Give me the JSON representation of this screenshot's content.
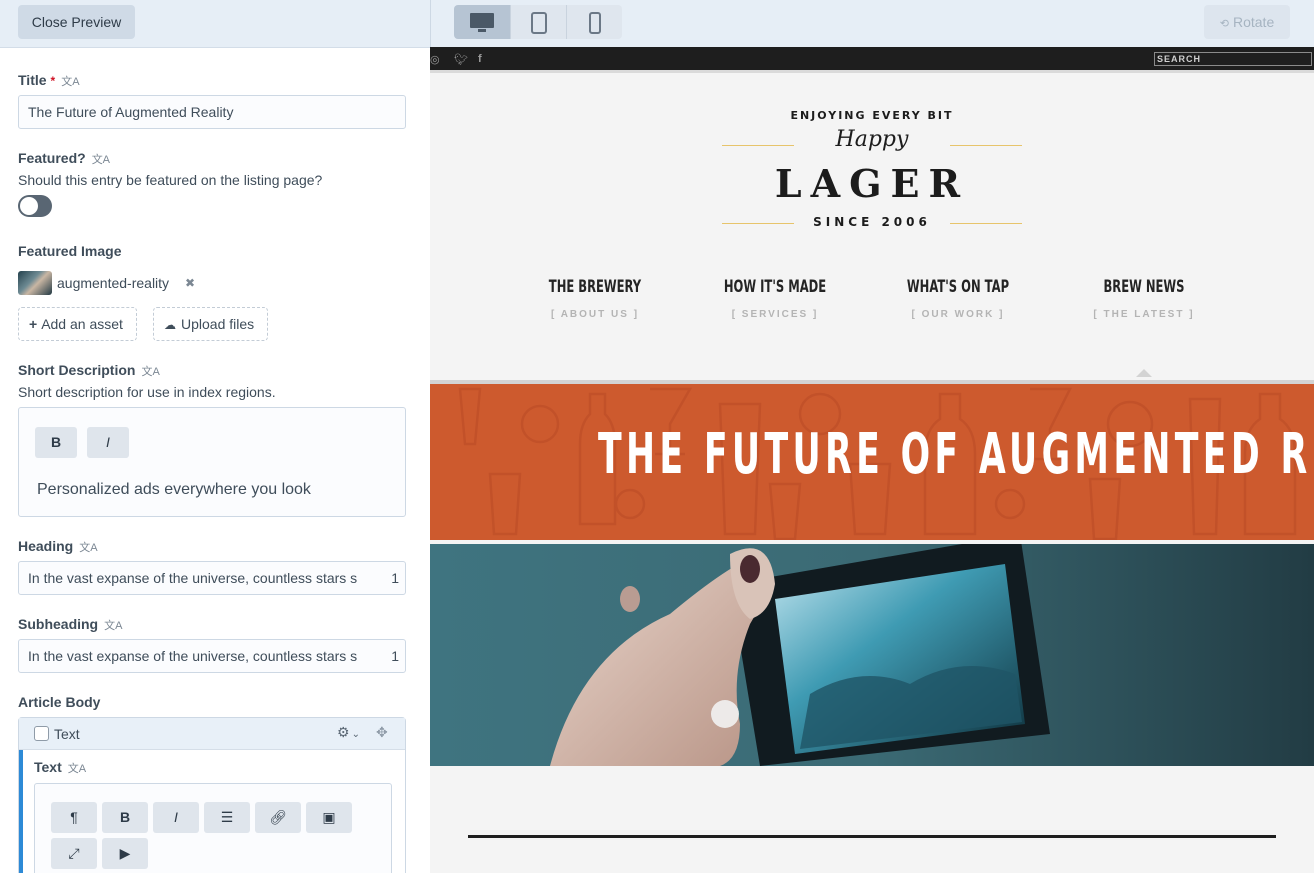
{
  "editor": {
    "close_preview": "Close Preview",
    "title": {
      "label": "Title",
      "required_mark": "*",
      "value": "The Future of Augmented Reality"
    },
    "featured": {
      "label": "Featured?",
      "help": "Should this entry be featured on the listing page?",
      "value": false
    },
    "featured_image": {
      "label": "Featured Image",
      "asset_name": "augmented-reality",
      "add_asset": "Add an asset",
      "upload_files": "Upload files"
    },
    "short_description": {
      "label": "Short Description",
      "help": "Short description for use in index regions.",
      "bold": "B",
      "italic": "I",
      "value": "Personalized ads everywhere you look"
    },
    "heading": {
      "label": "Heading",
      "value": "In the vast expanse of the universe, countless stars s",
      "count": "1"
    },
    "subheading": {
      "label": "Subheading",
      "value": "In the vast expanse of the universe, countless stars s",
      "count": "1"
    },
    "article_body": {
      "label": "Article Body",
      "block_type": "Text",
      "field_label": "Text",
      "toolbar": [
        "¶",
        "B",
        "I",
        "list",
        "link",
        "image",
        "fullscreen",
        "video"
      ]
    },
    "translate_icon_glyph": "文A"
  },
  "preview": {
    "devices": [
      "desktop",
      "tablet",
      "phone"
    ],
    "active_device": "desktop",
    "rotate": "Rotate",
    "site": {
      "search_placeholder": "SEARCH",
      "logo": {
        "tagline": "ENJOYING EVERY BIT",
        "script": "Happy",
        "name": "LAGER",
        "since": "SINCE 2006"
      },
      "nav": [
        {
          "label": "THE BREWERY",
          "sub": "[ ABOUT US ]"
        },
        {
          "label": "HOW IT'S MADE",
          "sub": "[ SERVICES ]"
        },
        {
          "label": "WHAT'S ON TAP",
          "sub": "[ OUR WORK ]"
        },
        {
          "label": "BREW NEWS",
          "sub": "[ THE LATEST ]"
        }
      ],
      "banner_title": "THE FUTURE OF AUGMENTED REALITY"
    }
  },
  "colors": {
    "accent_orange": "#cd5a2e",
    "logo_rule": "#e7c46b",
    "editor_bg": "#e6eef6",
    "active_block": "#2d8ad6"
  }
}
